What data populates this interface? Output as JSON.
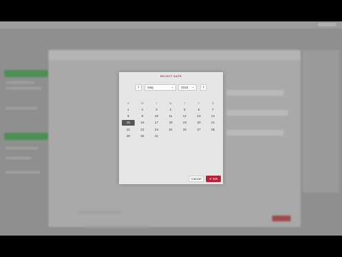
{
  "dialog": {
    "title": "SELECT DATE",
    "prev_icon": "chevron-left-icon",
    "next_icon": "chevron-right-icon",
    "month": "May",
    "year": "2016",
    "weekday_headers": [
      "S",
      "M",
      "T",
      "W",
      "T",
      "F",
      "S"
    ],
    "weeks": [
      [
        "1",
        "2",
        "3",
        "4",
        "5",
        "6",
        "7"
      ],
      [
        "8",
        "9",
        "10",
        "11",
        "12",
        "13",
        "14"
      ],
      [
        "15",
        "16",
        "17",
        "18",
        "19",
        "20",
        "21"
      ],
      [
        "22",
        "23",
        "24",
        "25",
        "26",
        "27",
        "28"
      ],
      [
        "29",
        "30",
        "31",
        "",
        "",
        "",
        ""
      ]
    ],
    "selected_day": "15",
    "cancel_label": "Cancel",
    "set_label": "Set",
    "set_icon": "check-icon"
  },
  "colors": {
    "accent": "#b3243a",
    "title": "#b03a4a",
    "selected_bg": "#555555",
    "overlay": "#8f8f8f"
  }
}
